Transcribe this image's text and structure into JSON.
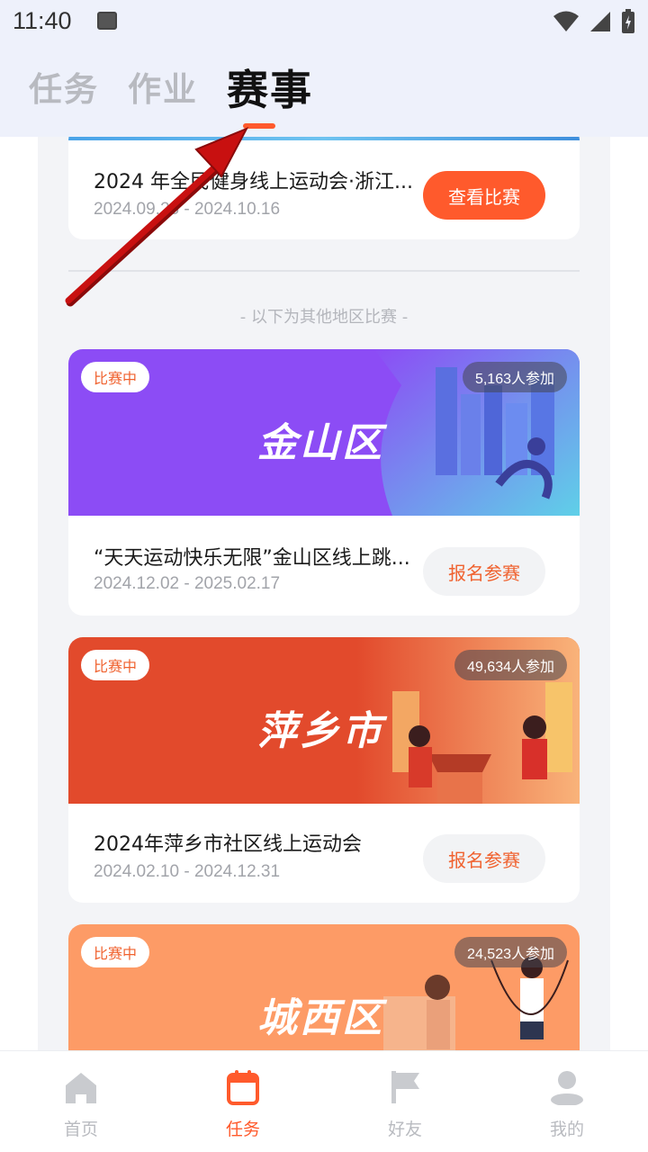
{
  "status_bar": {
    "time": "11:40"
  },
  "header": {
    "tabs": [
      {
        "label": "任务",
        "active": false
      },
      {
        "label": "作业",
        "active": false
      },
      {
        "label": "赛事",
        "active": true
      }
    ]
  },
  "featured_event": {
    "title": "2024 年全民健身线上运动会·浙江...",
    "date_range": "2024.09.26 - 2024.10.16",
    "button": "查看比赛"
  },
  "other_region_note": "- 以下为其他地区比赛 -",
  "events": [
    {
      "status": "比赛中",
      "participants": "5,163人参加",
      "banner_name": "金山区",
      "banner_color": "#8c4cf5",
      "title": "“天天运动快乐无限”金山区线上跳...",
      "date_range": "2024.12.02 - 2025.02.17",
      "button": "报名参赛"
    },
    {
      "status": "比赛中",
      "participants": "49,634人参加",
      "banner_name": "萍乡市",
      "banner_color": "#e24a2c",
      "title": "2024年萍乡市社区线上运动会",
      "date_range": "2024.02.10 - 2024.12.31",
      "button": "报名参赛"
    },
    {
      "status": "比赛中",
      "participants": "24,523人参加",
      "banner_name": "城西区",
      "banner_color": "#fd9b66"
    }
  ],
  "bottom_nav": [
    {
      "label": "首页",
      "icon": "home-icon",
      "active": false
    },
    {
      "label": "任务",
      "icon": "calendar-icon",
      "active": true
    },
    {
      "label": "好友",
      "icon": "flag-icon",
      "active": false
    },
    {
      "label": "我的",
      "icon": "person-icon",
      "active": false
    }
  ],
  "colors": {
    "accent": "#ff5a2c",
    "header_bg": "#eef1fb",
    "annotation_arrow": "#c81010"
  }
}
